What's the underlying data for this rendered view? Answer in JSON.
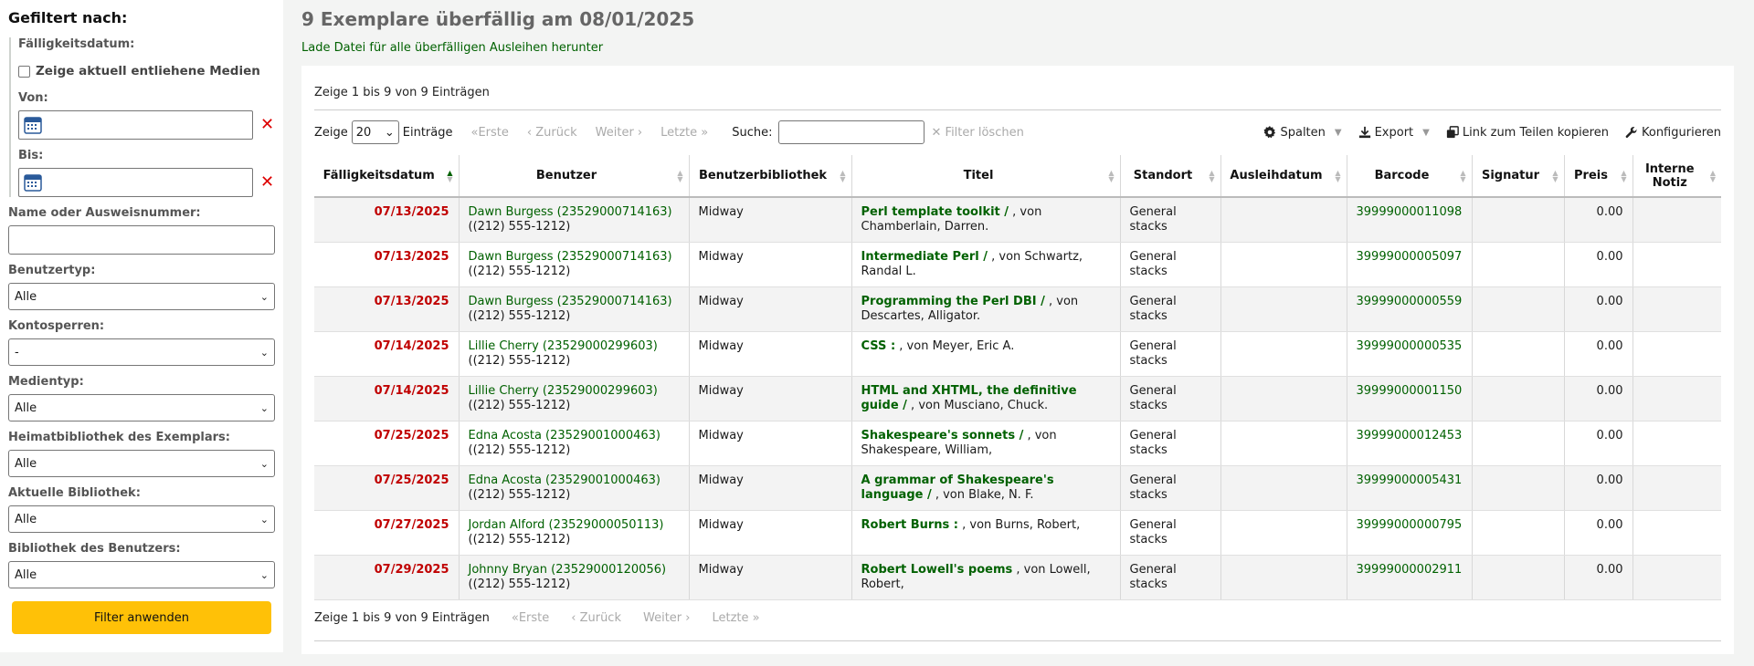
{
  "sidebar": {
    "title": "Gefiltert nach:",
    "due_date_label": "Fälligkeitsdatum:",
    "show_checked_out_label": "Zeige aktuell entliehene Medien",
    "from_label": "Von:",
    "to_label": "Bis:",
    "clear_glyph": "✕",
    "name_label": "Name oder Ausweisnummer:",
    "name_value": "",
    "patron_type_label": "Benutzertyp:",
    "patron_type_value": "Alle",
    "account_blocks_label": "Kontosperren:",
    "account_blocks_value": "-",
    "media_type_label": "Medientyp:",
    "media_type_value": "Alle",
    "home_library_label": "Heimatbibliothek des Exemplars:",
    "home_library_value": "Alle",
    "current_library_label": "Aktuelle Bibliothek:",
    "current_library_value": "Alle",
    "patron_library_label": "Bibliothek des Benutzers:",
    "patron_library_value": "Alle",
    "apply_label": "Filter anwenden"
  },
  "main": {
    "title": "9 Exemplare überfällig am 08/01/2025",
    "download_link": "Lade Datei für alle überfälligen Ausleihen herunter",
    "info": "Zeige 1 bis 9 von 9 Einträgen",
    "show_label": "Zeige",
    "page_size": "20",
    "entries_label": "Einträge",
    "first": "«Erste",
    "prev": "‹ Zurück",
    "next": "Weiter ›",
    "last": "Letzte »",
    "search_label": "Suche:",
    "search_value": "",
    "clear_filter": "✕ Filter löschen",
    "columns_btn": "Spalten",
    "export_btn": "Export",
    "copy_link_btn": "Link zum Teilen kopieren",
    "configure_btn": "Konfigurieren",
    "footer_info": "Zeige 1 bis 9 von 9 Einträgen"
  },
  "table": {
    "headers": [
      "Fälligkeitsdatum",
      "Benutzer",
      "Benutzerbibliothek",
      "Titel",
      "Standort",
      "Ausleihdatum",
      "Barcode",
      "Signatur",
      "Preis",
      "Interne Notiz"
    ],
    "rows": [
      {
        "due": "07/13/2025",
        "patron": "Dawn Burgess (23529000714163)",
        "phone": "((212) 555-1212)",
        "library": "Midway",
        "title": "Perl template toolkit /",
        "author": " , von Chamberlain, Darren.",
        "location": "General stacks",
        "checkout": "",
        "barcode": "39999000011098",
        "callnumber": "",
        "price": "0.00",
        "note": ""
      },
      {
        "due": "07/13/2025",
        "patron": "Dawn Burgess (23529000714163)",
        "phone": "((212) 555-1212)",
        "library": "Midway",
        "title": "Intermediate Perl /",
        "author": " , von Schwartz, Randal L.",
        "location": "General stacks",
        "checkout": "",
        "barcode": "39999000005097",
        "callnumber": "",
        "price": "0.00",
        "note": ""
      },
      {
        "due": "07/13/2025",
        "patron": "Dawn Burgess (23529000714163)",
        "phone": "((212) 555-1212)",
        "library": "Midway",
        "title": "Programming the Perl DBI /",
        "author": " , von Descartes, Alligator.",
        "location": "General stacks",
        "checkout": "",
        "barcode": "39999000000559",
        "callnumber": "",
        "price": "0.00",
        "note": ""
      },
      {
        "due": "07/14/2025",
        "patron": "Lillie Cherry (23529000299603)",
        "phone": "((212) 555-1212)",
        "library": "Midway",
        "title": "CSS :",
        "author": " , von Meyer, Eric A.",
        "location": "General stacks",
        "checkout": "",
        "barcode": "39999000000535",
        "callnumber": "",
        "price": "0.00",
        "note": ""
      },
      {
        "due": "07/14/2025",
        "patron": "Lillie Cherry (23529000299603)",
        "phone": "((212) 555-1212)",
        "library": "Midway",
        "title": "HTML and XHTML, the definitive guide /",
        "author": " , von Musciano, Chuck.",
        "location": "General stacks",
        "checkout": "",
        "barcode": "39999000001150",
        "callnumber": "",
        "price": "0.00",
        "note": ""
      },
      {
        "due": "07/25/2025",
        "patron": "Edna Acosta (23529001000463)",
        "phone": "((212) 555-1212)",
        "library": "Midway",
        "title": "Shakespeare's sonnets /",
        "author": " , von Shakespeare, William,",
        "location": "General stacks",
        "checkout": "",
        "barcode": "39999000012453",
        "callnumber": "",
        "price": "0.00",
        "note": ""
      },
      {
        "due": "07/25/2025",
        "patron": "Edna Acosta (23529001000463)",
        "phone": "((212) 555-1212)",
        "library": "Midway",
        "title": "A grammar of Shakespeare's language /",
        "author": " , von Blake, N. F.",
        "location": "General stacks",
        "checkout": "",
        "barcode": "39999000005431",
        "callnumber": "",
        "price": "0.00",
        "note": ""
      },
      {
        "due": "07/27/2025",
        "patron": "Jordan Alford (23529000050113)",
        "phone": "((212) 555-1212)",
        "library": "Midway",
        "title": "Robert Burns :",
        "author": " , von Burns, Robert,",
        "location": "General stacks",
        "checkout": "",
        "barcode": "39999000000795",
        "callnumber": "",
        "price": "0.00",
        "note": ""
      },
      {
        "due": "07/29/2025",
        "patron": "Johnny Bryan (23529000120056)",
        "phone": "((212) 555-1212)",
        "library": "Midway",
        "title": "Robert Lowell's poems",
        "author": " , von Lowell, Robert,",
        "location": "General stacks",
        "checkout": "",
        "barcode": "39999000002911",
        "callnumber": "",
        "price": "0.00",
        "note": ""
      }
    ]
  }
}
